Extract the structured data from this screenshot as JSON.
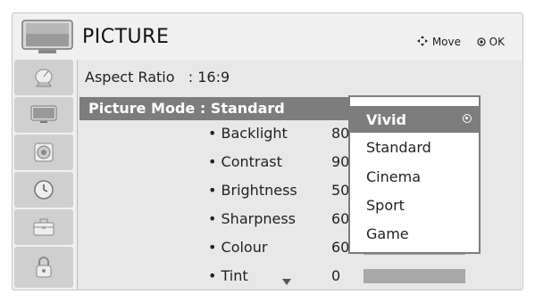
{
  "header": {
    "title": "PICTURE",
    "move_hint": "Move",
    "ok_hint": "OK"
  },
  "sidebar": {
    "items": [
      {
        "icon": "satellite-dish-icon"
      },
      {
        "icon": "tv-screen-icon"
      },
      {
        "icon": "speaker-icon"
      },
      {
        "icon": "clock-icon"
      },
      {
        "icon": "toolbox-icon"
      },
      {
        "icon": "lock-icon"
      }
    ]
  },
  "content": {
    "aspect_ratio": "Aspect Ratio   : 16:9",
    "picture_mode": "Picture Mode : Standard",
    "settings": [
      {
        "label": "• Backlight",
        "value": "80"
      },
      {
        "label": "• Contrast",
        "value": "90"
      },
      {
        "label": "• Brightness",
        "value": "50"
      },
      {
        "label": "• Sharpness",
        "value": "60"
      },
      {
        "label": "• Colour",
        "value": "60"
      },
      {
        "label": "• Tint",
        "value": "0"
      }
    ]
  },
  "dropdown": {
    "options": [
      "Vivid",
      "Standard",
      "Cinema",
      "Sport",
      "Game"
    ],
    "selected": "Vivid"
  },
  "colors": {
    "highlight": "#7d7d7d",
    "panel": "#f0f0f0",
    "sidebar_tile": "#cfcfcf"
  }
}
